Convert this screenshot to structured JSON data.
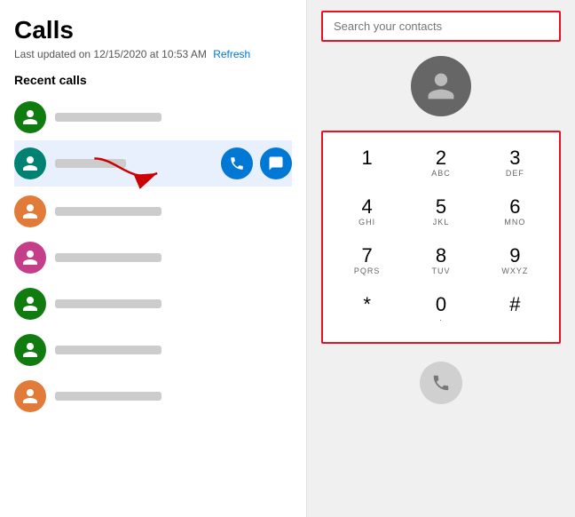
{
  "header": {
    "title": "Calls",
    "last_updated": "Last updated on 12/15/2020 at 10:53 AM",
    "refresh_label": "Refresh"
  },
  "section": {
    "recent_calls": "Recent calls"
  },
  "search": {
    "placeholder": "Search your contacts"
  },
  "dialpad": {
    "keys": [
      {
        "number": "1",
        "letters": ""
      },
      {
        "number": "2",
        "letters": "ABC"
      },
      {
        "number": "3",
        "letters": "DEF"
      },
      {
        "number": "4",
        "letters": "GHI"
      },
      {
        "number": "5",
        "letters": "JKL"
      },
      {
        "number": "6",
        "letters": "MNO"
      },
      {
        "number": "7",
        "letters": "PQRS"
      },
      {
        "number": "8",
        "letters": "TUV"
      },
      {
        "number": "9",
        "letters": "WXYZ"
      },
      {
        "number": "*",
        "letters": ""
      },
      {
        "number": "0",
        "letters": "·"
      },
      {
        "number": "#",
        "letters": ""
      }
    ]
  },
  "avatars": [
    {
      "color": "green"
    },
    {
      "color": "teal"
    },
    {
      "color": "orange"
    },
    {
      "color": "pink"
    },
    {
      "color": "green2"
    },
    {
      "color": "green3"
    },
    {
      "color": "orange2"
    }
  ]
}
